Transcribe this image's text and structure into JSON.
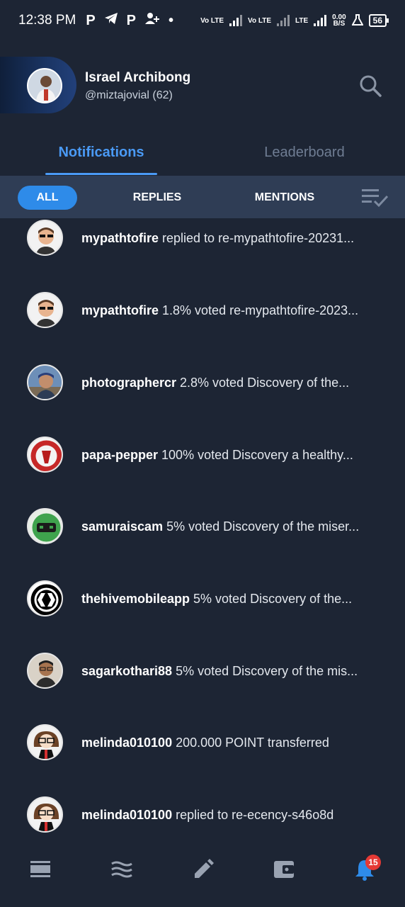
{
  "status_bar": {
    "time": "12:38 PM",
    "app_icons": [
      "P",
      "telegram-icon",
      "P",
      "add-person-icon",
      "•"
    ],
    "net1": "Vo LTE",
    "net2": "Vo LTE",
    "net3": "LTE",
    "speed": "0.00",
    "speed_unit": "B/S",
    "battery": "56"
  },
  "profile": {
    "name": "Israel Archibong",
    "handle": "@miztajovial (62)"
  },
  "tabs": {
    "notifications": "Notifications",
    "leaderboard": "Leaderboard"
  },
  "filters": {
    "all": "ALL",
    "replies": "REPLIES",
    "mentions": "MENTIONS"
  },
  "notifications": [
    {
      "user": "mypathtofire",
      "text": " replied to re-mypathtofire-20231...",
      "avatar": "man-sunglasses"
    },
    {
      "user": "mypathtofire",
      "text": " 1.8%  voted re-mypathtofire-2023...",
      "avatar": "man-sunglasses"
    },
    {
      "user": "photographercr",
      "text": " 2.8%  voted Discovery of the...",
      "avatar": "man-outdoor"
    },
    {
      "user": "papa-pepper",
      "text": " 100%  voted Discovery a healthy...",
      "avatar": "papa-pepper-logo"
    },
    {
      "user": "samuraiscam",
      "text": " 5%  voted Discovery of the miser...",
      "avatar": "green-robot"
    },
    {
      "user": "thehivemobileapp",
      "text": " 5%  voted Discovery of the...",
      "avatar": "hive-logo"
    },
    {
      "user": "sagarkothari88",
      "text": " 5%  voted Discovery of the mis...",
      "avatar": "man-glasses"
    },
    {
      "user": "melinda010100",
      "text": " 200.000 POINT transferred",
      "avatar": "cartoon-girl"
    },
    {
      "user": "melinda010100",
      "text": " replied to re-ecency-s46o8d",
      "avatar": "cartoon-girl"
    }
  ],
  "bottom_nav": {
    "items": [
      "feed-icon",
      "waves-icon",
      "edit-icon",
      "wallet-icon",
      "bell-icon"
    ],
    "badge": "15"
  },
  "colors": {
    "background": "#1d2534",
    "accent": "#2e8be9",
    "filter_bar": "#2f3d55",
    "badge": "#e53935"
  }
}
